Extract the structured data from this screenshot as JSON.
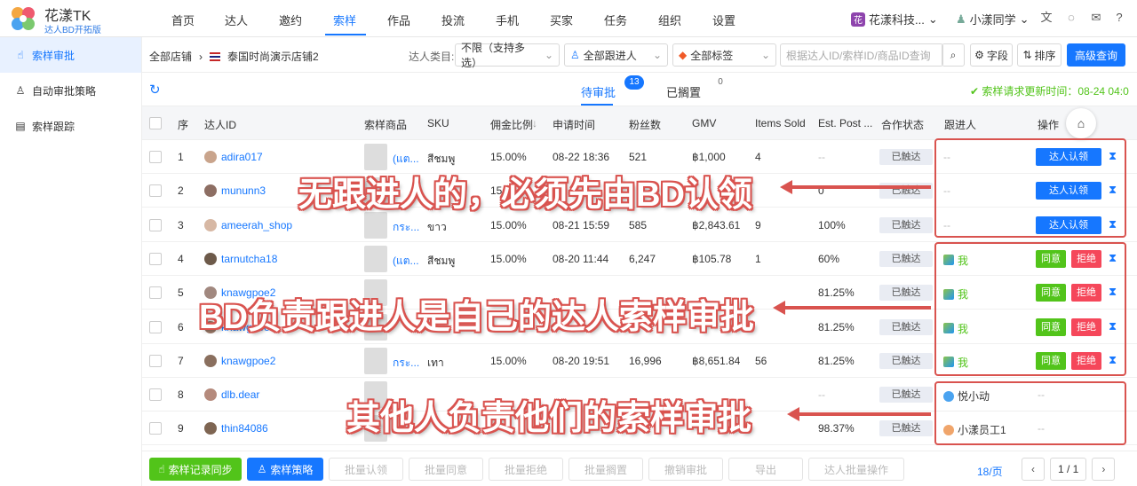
{
  "brand": {
    "title": "花漾TK",
    "subtitle": "达人BD开拓版"
  },
  "nav": {
    "items": [
      "首页",
      "达人",
      "邀约",
      "索样",
      "作品",
      "投流",
      "手机",
      "买家",
      "任务",
      "组织",
      "设置"
    ],
    "active_index": 3
  },
  "header_right": {
    "org_badge": "花",
    "org_name": "花漾科技...",
    "user": "小漾同学"
  },
  "sidebar": {
    "items": [
      {
        "icon": "hand-icon",
        "label": "索样审批",
        "active": true
      },
      {
        "icon": "user-icon",
        "label": "自动审批策略",
        "active": false
      },
      {
        "icon": "book-icon",
        "label": "索样跟踪",
        "active": false
      }
    ]
  },
  "filters": {
    "breadcrumb_root": "全部店铺",
    "breadcrumb_store": "泰国时尚演示店铺2",
    "category_label": "达人类目:",
    "category_value": "不限（支持多选）",
    "follower_value": "全部跟进人",
    "tag_value": "全部标签",
    "search_placeholder": "根据达人ID/索样ID/商品ID查询",
    "fields_label": "字段",
    "sort_label": "排序",
    "advanced_label": "高级查询"
  },
  "tabs": [
    {
      "label": "待审批",
      "badge": "13"
    },
    {
      "label": "已搁置",
      "badge": "0"
    }
  ],
  "update_time": "索样请求更新时间：08-24 04:0",
  "table": {
    "headers": [
      "序",
      "达人ID",
      "索样商品",
      "SKU",
      "佣金比例",
      "申请时间",
      "粉丝数",
      "GMV",
      "Items Sold",
      "Est. Post ...",
      "合作状态",
      "跟进人",
      "操作"
    ],
    "rows": [
      {
        "no": "1",
        "id": "adira017",
        "product": "(แต...",
        "sku": "สีชมพู",
        "rate": "15.00%",
        "time": "08-22 18:36",
        "fans": "521",
        "gmv": "฿1,000",
        "sold": "4",
        "post": "--",
        "status": "已触达",
        "follower": "--",
        "action": "claim"
      },
      {
        "no": "2",
        "id": "mununn3",
        "product": "",
        "sku": "",
        "rate": "15.0",
        "time": "",
        "fans": "",
        "gmv": "",
        "sold": "",
        "post": "0",
        "status": "已触达",
        "follower": "--",
        "action": "claim"
      },
      {
        "no": "3",
        "id": "ameerah_shop",
        "product": "กระ...",
        "sku": "ขาว",
        "rate": "15.00%",
        "time": "08-21 15:59",
        "fans": "585",
        "gmv": "฿2,843.61",
        "sold": "9",
        "post": "100%",
        "status": "已触达",
        "follower": "--",
        "action": "claim"
      },
      {
        "no": "4",
        "id": "tarnutcha18",
        "product": "(แต...",
        "sku": "สีชมพู",
        "rate": "15.00%",
        "time": "08-20 11:44",
        "fans": "6,247",
        "gmv": "฿105.78",
        "sold": "1",
        "post": "60%",
        "status": "已触达",
        "follower": "我",
        "action": "approve"
      },
      {
        "no": "5",
        "id": "knawgpoe2",
        "product": "",
        "sku": "",
        "rate": "",
        "time": "",
        "fans": "",
        "gmv": "",
        "sold": "",
        "post": "81.25%",
        "status": "已触达",
        "follower": "我",
        "action": "approve"
      },
      {
        "no": "6",
        "id": "knawgpoe2",
        "product": "",
        "sku": "",
        "rate": "",
        "time": "",
        "fans": "",
        "gmv": "",
        "sold": "",
        "post": "81.25%",
        "status": "已触达",
        "follower": "我",
        "action": "approve"
      },
      {
        "no": "7",
        "id": "knawgpoe2",
        "product": "กระ...",
        "sku": "เทา",
        "rate": "15.00%",
        "time": "08-20 19:51",
        "fans": "16,996",
        "gmv": "฿8,651.84",
        "sold": "56",
        "post": "81.25%",
        "status": "已触达",
        "follower": "我",
        "action": "approve"
      },
      {
        "no": "8",
        "id": "dlb.dear",
        "product": "",
        "sku": "",
        "rate": "",
        "time": "",
        "fans": "",
        "gmv": "",
        "sold": "",
        "post": "--",
        "status": "已触达",
        "follower": "悦小动",
        "action": "none"
      },
      {
        "no": "9",
        "id": "thin84086",
        "product": "",
        "sku": "",
        "rate": "",
        "time": "",
        "fans": "",
        "gmv": "",
        "sold": "",
        "post": "98.37%",
        "status": "已触达",
        "follower": "小漾员工1",
        "action": "none"
      }
    ],
    "claim_label": "达人认领",
    "agree_label": "同意",
    "reject_label": "拒绝"
  },
  "annotations": [
    "无跟进人的，必须先由BD认领",
    "BD负责跟进人是自己的达人索样审批",
    "其他人负责他们的索样审批"
  ],
  "bottom": {
    "sync": "索样记录同步",
    "policy": "索样策略",
    "bulk_claim": "批量认领",
    "bulk_agree": "批量同意",
    "bulk_reject": "批量拒绝",
    "bulk_shelve": "批量搁置",
    "withdraw": "撤销审批",
    "export": "导出",
    "bulk_ops": "达人批量操作",
    "count": "18/页",
    "page": "1 / 1"
  },
  "colors": {
    "accent": "#1677ff",
    "green": "#52c41a",
    "red": "#f5475a",
    "annotation": "#d9534f"
  }
}
